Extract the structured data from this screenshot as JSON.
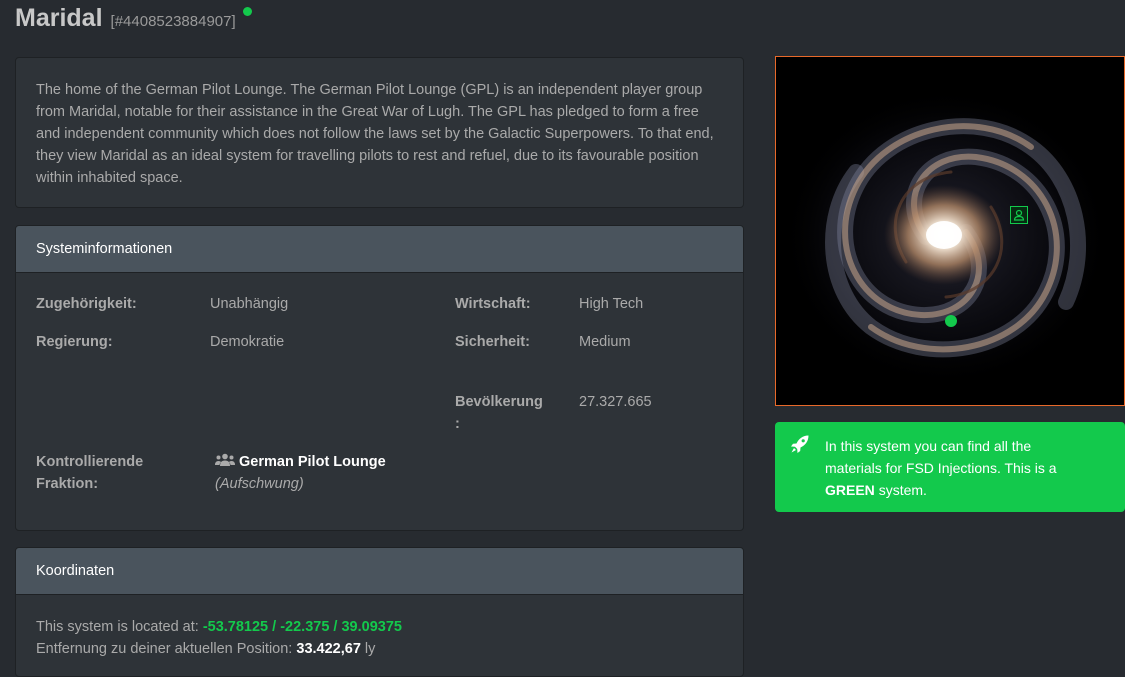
{
  "header": {
    "title": "Maridal",
    "system_id": "[#4408523884907]",
    "status_color": "#13c94c"
  },
  "description": "The home of the German Pilot Lounge. The German Pilot Lounge (GPL) is an independent player group from Maridal, notable for their assistance in the Great War of Lugh. The GPL has pledged to form a free and independent community which does not follow the laws set by the Galactic Superpowers. To that end, they view Maridal as an ideal system for travelling pilots to rest and refuel, due to its favourable position within inhabited space.",
  "info": {
    "heading": "Systeminformationen",
    "allegiance": {
      "label": "Zugehörigkeit:",
      "value": "Unabhängig"
    },
    "government": {
      "label": "Regierung:",
      "value": "Demokratie"
    },
    "economy": {
      "label": "Wirtschaft:",
      "value": "High Tech"
    },
    "security": {
      "label": "Sicherheit:",
      "value": "Medium"
    },
    "population": {
      "label_line1": "Bevölkerung",
      "label_line2": ":",
      "value": "27.327.665"
    },
    "faction": {
      "label_line1": "Kontrollierende",
      "label_line2": "Fraktion:",
      "name": "German Pilot Lounge",
      "state": "(Aufschwung)",
      "icon": "users-icon"
    }
  },
  "coordinates": {
    "heading": "Koordinaten",
    "location_prefix": "This system is located at:",
    "location_value": "-53.78125 / -22.375 / 39.09375",
    "distance_prefix": "Entfernung zu deiner aktuellen Position:",
    "distance_value": "33.422,67",
    "distance_unit": "ly"
  },
  "galaxy_map": {
    "icons": [
      "galaxy-image",
      "system-marker-dot",
      "station-icon"
    ],
    "border_color": "#e8692a"
  },
  "alert": {
    "icon": "rocket-icon",
    "line1": "In this system you can find all the",
    "line2": "materials for FSD Injections. This is a",
    "highlight": "GREEN",
    "suffix": "system.",
    "color": "#13c94c"
  }
}
